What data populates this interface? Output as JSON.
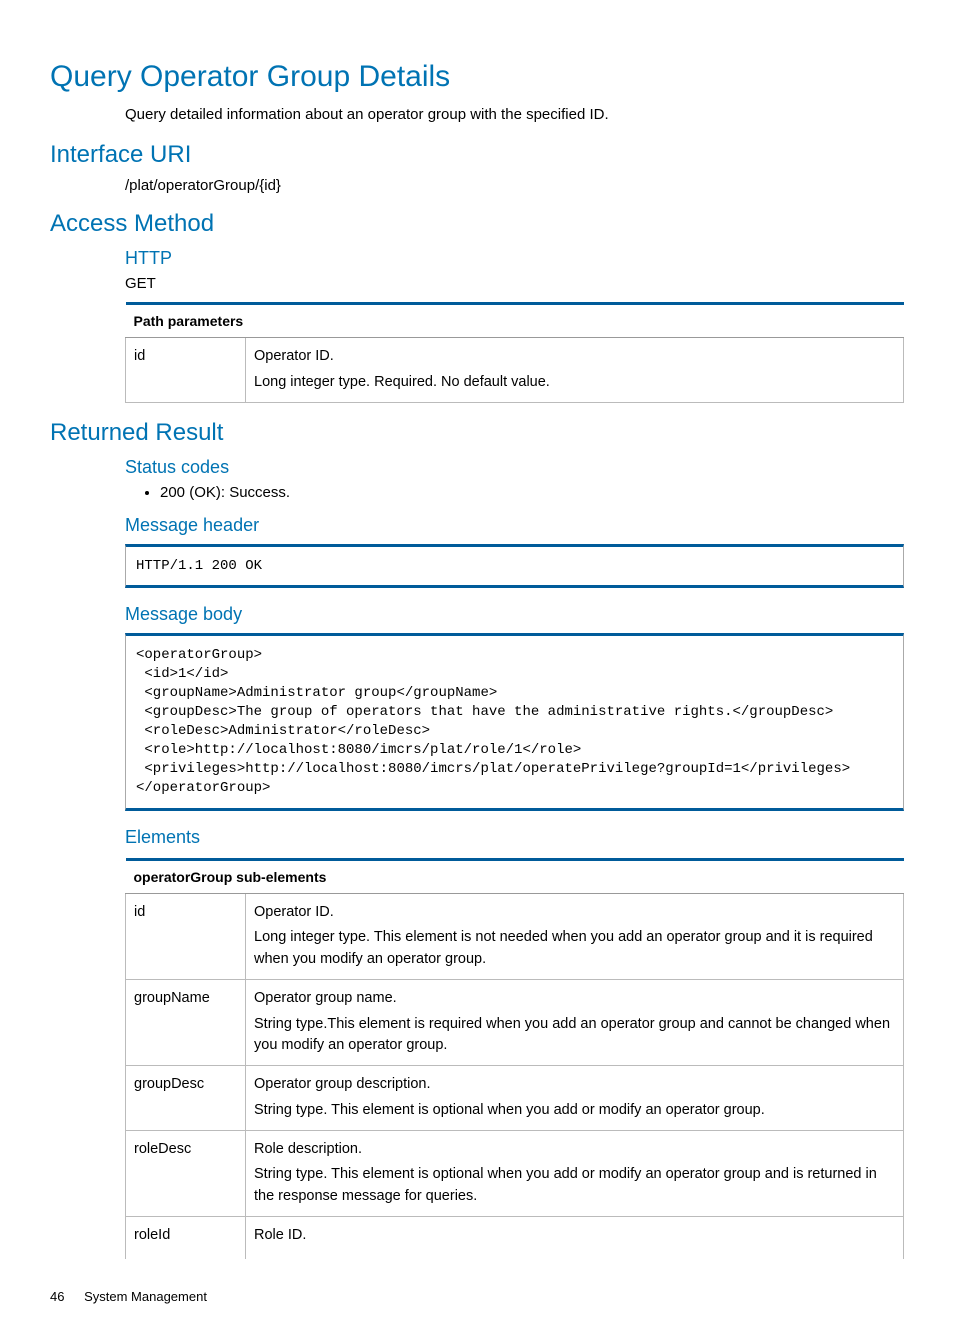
{
  "page_title": "Query Operator Group Details",
  "intro": "Query detailed information about an operator group with the specified ID.",
  "sections": {
    "interface_uri": {
      "heading": "Interface URI",
      "value": "/plat/operatorGroup/{id}"
    },
    "access_method": {
      "heading": "Access Method",
      "http_label": "HTTP",
      "http_value": "GET"
    },
    "path_params": {
      "header": "Path parameters",
      "rows": [
        {
          "name": "id",
          "title": "Operator ID.",
          "detail": "Long integer type. Required. No default value."
        }
      ]
    },
    "returned_result": {
      "heading": "Returned Result",
      "status_codes": {
        "heading": "Status codes",
        "items": [
          "200 (OK): Success."
        ]
      },
      "message_header": {
        "heading": "Message header",
        "code": "HTTP/1.1 200 OK"
      },
      "message_body": {
        "heading": "Message body",
        "code": "<operatorGroup>\n <id>1</id>\n <groupName>Administrator group</groupName>\n <groupDesc>The group of operators that have the administrative rights.</groupDesc>\n <roleDesc>Administrator</roleDesc>\n <role>http://localhost:8080/imcrs/plat/role/1</role>\n <privileges>http://localhost:8080/imcrs/plat/operatePrivilege?groupId=1</privileges>\n</operatorGroup>"
      },
      "elements": {
        "heading": "Elements",
        "table_header": "operatorGroup sub-elements",
        "rows": [
          {
            "name": "id",
            "title": "Operator ID.",
            "detail": "Long integer type. This element is not needed when you add an operator group and it is required when you modify an operator group."
          },
          {
            "name": "groupName",
            "title": "Operator group name.",
            "detail": "String type.This element is required when you add an operator group and cannot be changed when you modify an operator group."
          },
          {
            "name": "groupDesc",
            "title": "Operator group description.",
            "detail": "String type. This element is optional when you add or modify an operator group."
          },
          {
            "name": "roleDesc",
            "title": "Role description.",
            "detail": "String type. This element is optional when you add or modify an operator group and is returned in the response message for queries."
          },
          {
            "name": "roleId",
            "title": "Role ID.",
            "detail": ""
          }
        ]
      }
    }
  },
  "footer": {
    "page_number": "46",
    "section": "System Management"
  }
}
